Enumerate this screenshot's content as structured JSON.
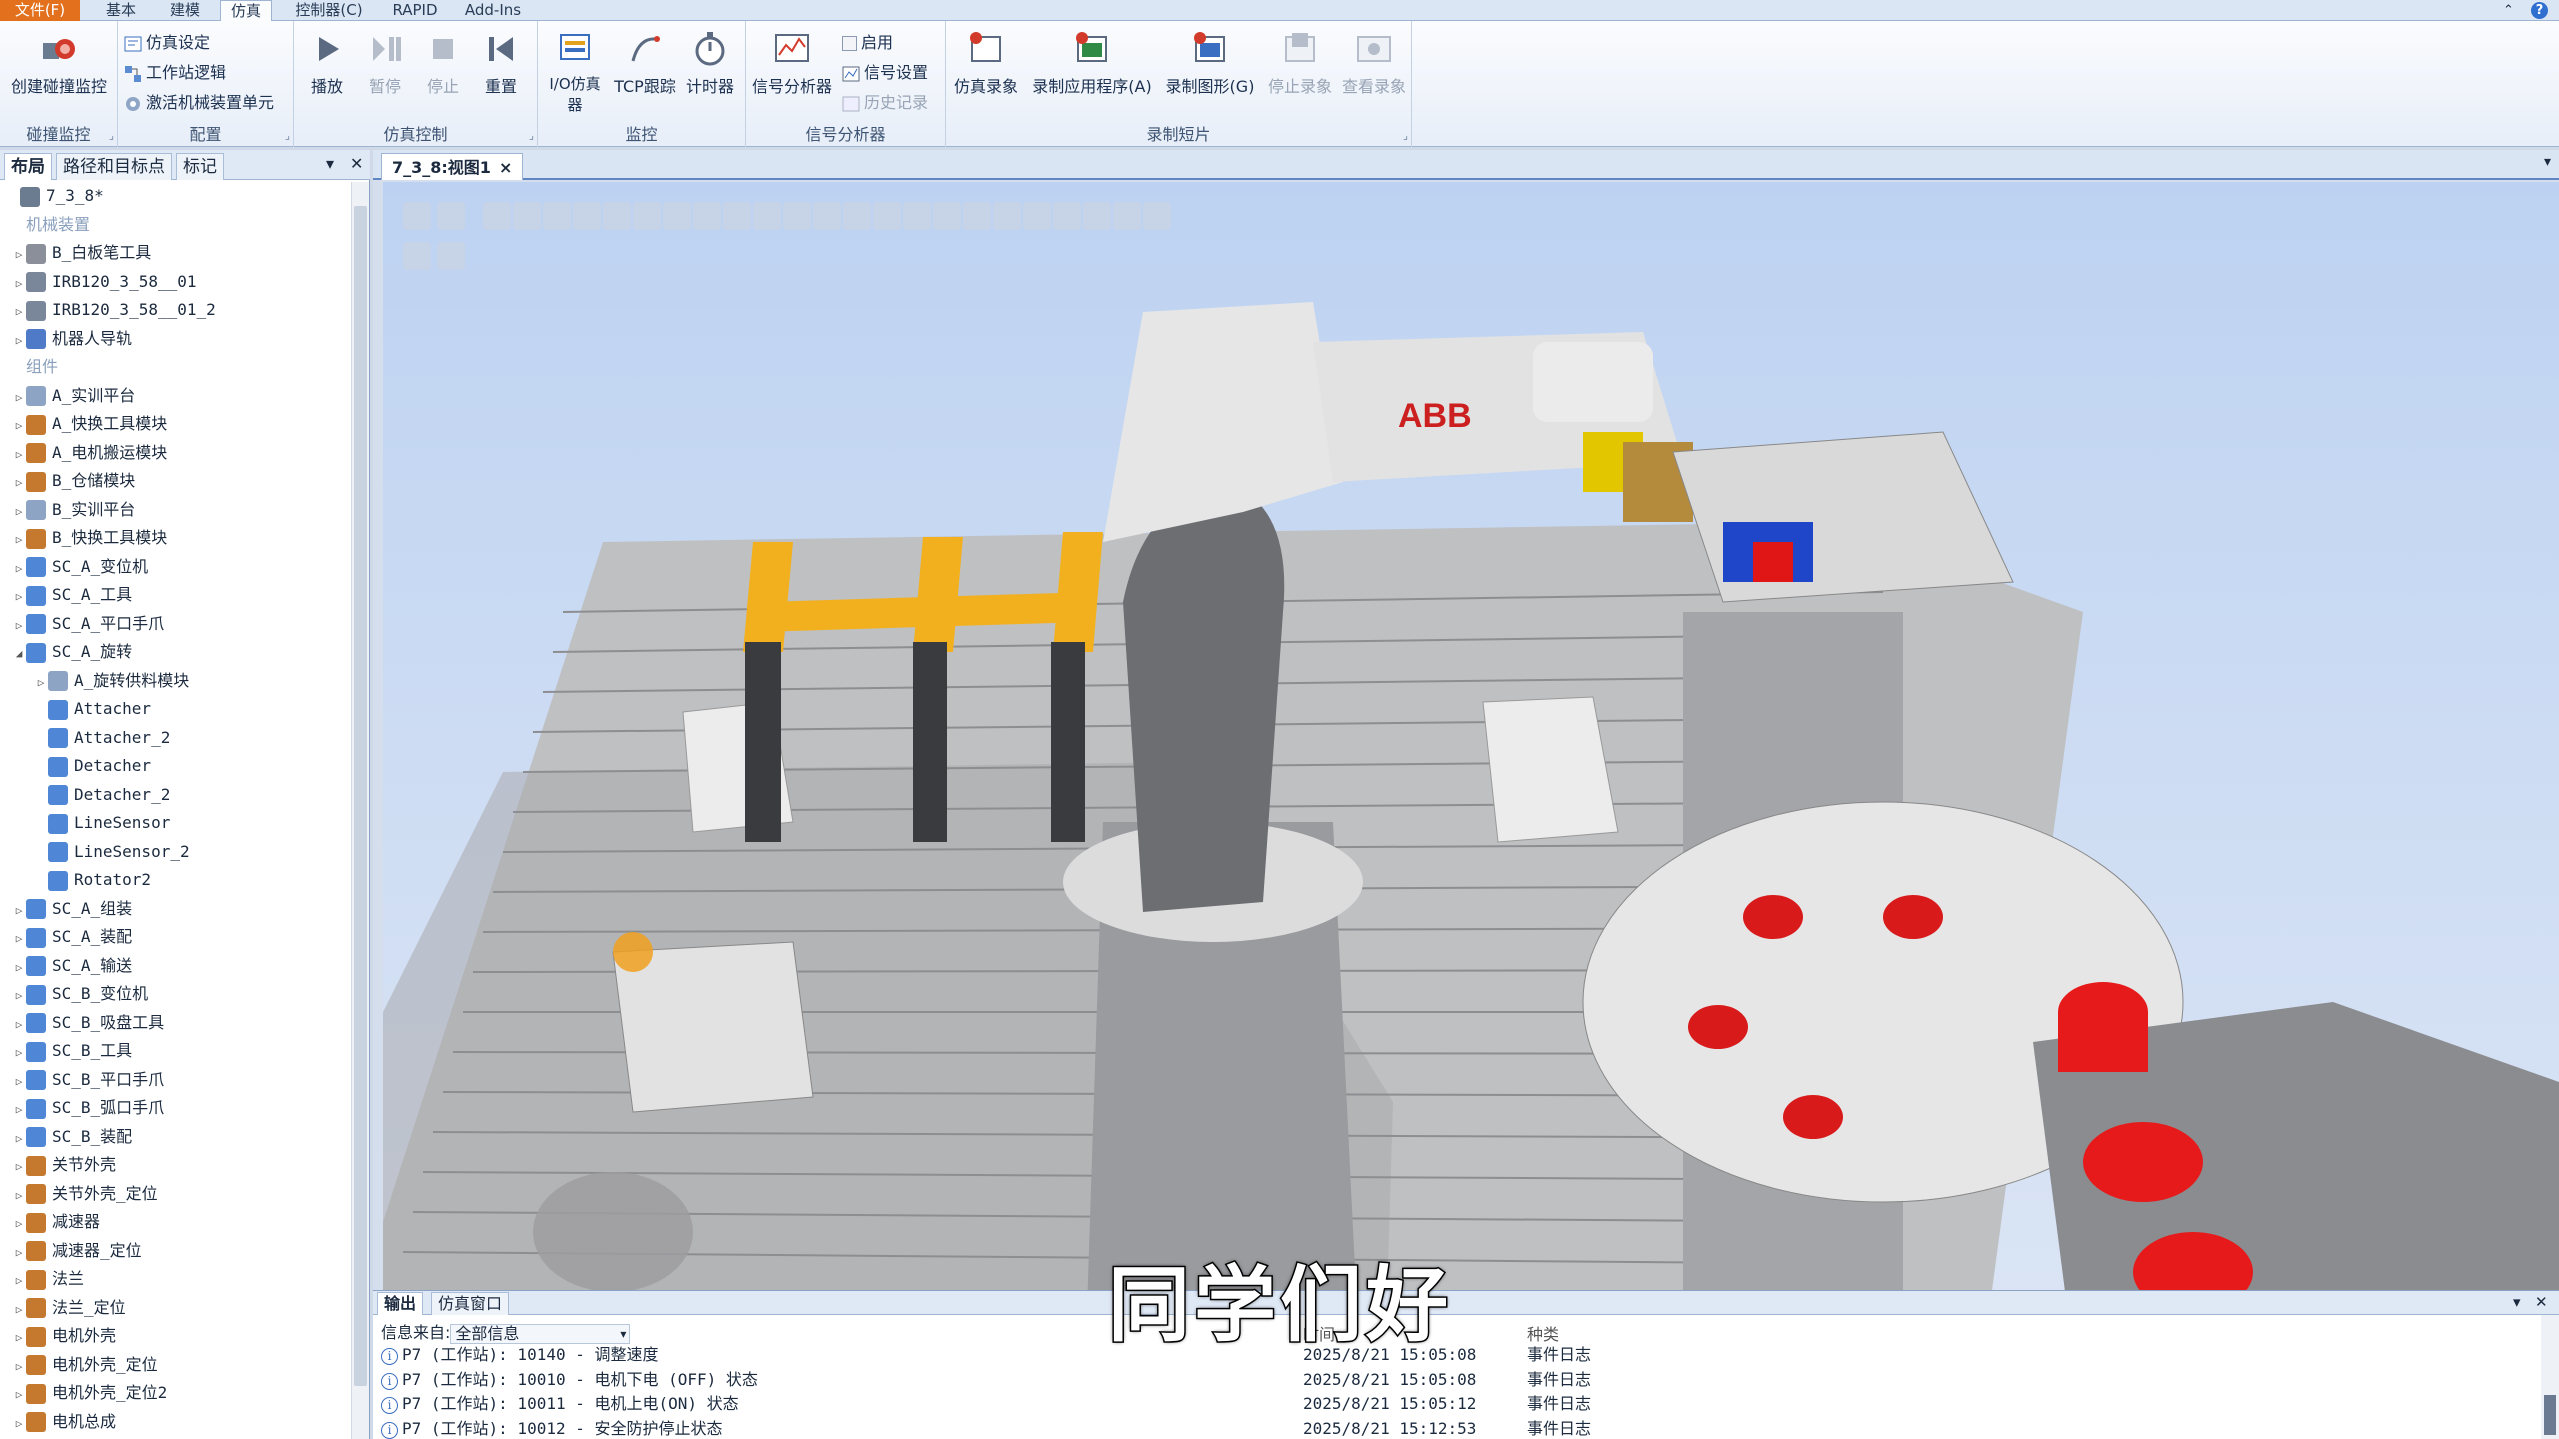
{
  "ribbon_tabs": {
    "file": "文件(F)",
    "home": "基本",
    "modeling": "建模",
    "simulation": "仿真",
    "controller": "控制器(C)",
    "rapid": "RAPID",
    "addins": "Add-Ins"
  },
  "ribbon": {
    "collision": {
      "create_label": "创建碰撞监控",
      "group_label": "碰撞监控"
    },
    "config": {
      "sim_setup": "仿真设定",
      "station_logic": "工作站逻辑",
      "activate_mech": "激活机械装置单元",
      "group_label": "配置"
    },
    "sim_control": {
      "play": "播放",
      "pause": "暂停",
      "stop": "停止",
      "reset": "重置",
      "group_label": "仿真控制"
    },
    "monitor": {
      "io_sim": "I/O仿真器",
      "tcp_trace": "TCP跟踪",
      "timer": "计时器",
      "group_label": "监控"
    },
    "signal_analyzer": {
      "analyzer": "信号分析器",
      "enable": "启用",
      "signal_settings": "信号设置",
      "history": "历史记录",
      "group_label": "信号分析器"
    },
    "recording": {
      "sim_record": "仿真录象",
      "record_app": "录制应用程序(A)",
      "record_graphics": "录制图形(G)",
      "stop_record": "停止录象",
      "view_record": "查看录象",
      "group_label": "录制短片"
    }
  },
  "left_panel": {
    "tabs": [
      "布局",
      "路径和目标点",
      "标记"
    ],
    "tree": [
      {
        "label": "7_3_8*",
        "level": 0,
        "icon": "station-icon",
        "twisty": "",
        "category": false
      },
      {
        "label": "机械装置",
        "level": 1,
        "icon": "",
        "twisty": "",
        "category": true
      },
      {
        "label": "B_白板笔工具",
        "level": 1,
        "icon": "tool-icon",
        "twisty": "▷",
        "category": false
      },
      {
        "label": "IRB120_3_58__01",
        "level": 1,
        "icon": "robot-icon",
        "twisty": "▷",
        "category": false
      },
      {
        "label": "IRB120_3_58__01_2",
        "level": 1,
        "icon": "robot-icon",
        "twisty": "▷",
        "category": false
      },
      {
        "label": "机器人导轨",
        "level": 1,
        "icon": "track-icon",
        "twisty": "▷",
        "category": false
      },
      {
        "label": "组件",
        "level": 1,
        "icon": "",
        "twisty": "",
        "category": true
      },
      {
        "label": "A_实训平台",
        "level": 1,
        "icon": "component-icon",
        "twisty": "▷",
        "category": false
      },
      {
        "label": "A_快换工具模块",
        "level": 1,
        "icon": "component-group-icon",
        "twisty": "▷",
        "category": false
      },
      {
        "label": "A_电机搬运模块",
        "level": 1,
        "icon": "component-group-icon",
        "twisty": "▷",
        "category": false
      },
      {
        "label": "B_仓储模块",
        "level": 1,
        "icon": "component-group-icon",
        "twisty": "▷",
        "category": false
      },
      {
        "label": "B_实训平台",
        "level": 1,
        "icon": "component-icon",
        "twisty": "▷",
        "category": false
      },
      {
        "label": "B_快换工具模块",
        "level": 1,
        "icon": "component-group-icon",
        "twisty": "▷",
        "category": false
      },
      {
        "label": "SC_A_变位机",
        "level": 1,
        "icon": "smart-component-icon",
        "twisty": "▷",
        "category": false
      },
      {
        "label": "SC_A_工具",
        "level": 1,
        "icon": "smart-component-icon",
        "twisty": "▷",
        "category": false
      },
      {
        "label": "SC_A_平口手爪",
        "level": 1,
        "icon": "smart-component-icon",
        "twisty": "▷",
        "category": false
      },
      {
        "label": "SC_A_旋转",
        "level": 1,
        "icon": "smart-component-icon",
        "twisty": "◢",
        "category": false
      },
      {
        "label": "A_旋转供料模块",
        "level": 2,
        "icon": "component-icon",
        "twisty": "▷",
        "category": false
      },
      {
        "label": "Attacher",
        "level": 2,
        "icon": "smart-component-icon",
        "twisty": "",
        "category": false
      },
      {
        "label": "Attacher_2",
        "level": 2,
        "icon": "smart-component-icon",
        "twisty": "",
        "category": false
      },
      {
        "label": "Detacher",
        "level": 2,
        "icon": "smart-component-icon",
        "twisty": "",
        "category": false
      },
      {
        "label": "Detacher_2",
        "level": 2,
        "icon": "smart-component-icon",
        "twisty": "",
        "category": false
      },
      {
        "label": "LineSensor",
        "level": 2,
        "icon": "smart-component-icon",
        "twisty": "",
        "category": false
      },
      {
        "label": "LineSensor_2",
        "level": 2,
        "icon": "smart-component-icon",
        "twisty": "",
        "category": false
      },
      {
        "label": "Rotator2",
        "level": 2,
        "icon": "smart-component-icon",
        "twisty": "",
        "category": false
      },
      {
        "label": "SC_A_组装",
        "level": 1,
        "icon": "smart-component-icon",
        "twisty": "▷",
        "category": false
      },
      {
        "label": "SC_A_装配",
        "level": 1,
        "icon": "smart-component-icon",
        "twisty": "▷",
        "category": false
      },
      {
        "label": "SC_A_输送",
        "level": 1,
        "icon": "smart-component-icon",
        "twisty": "▷",
        "category": false
      },
      {
        "label": "SC_B_变位机",
        "level": 1,
        "icon": "smart-component-icon",
        "twisty": "▷",
        "category": false
      },
      {
        "label": "SC_B_吸盘工具",
        "level": 1,
        "icon": "smart-component-icon",
        "twisty": "▷",
        "category": false
      },
      {
        "label": "SC_B_工具",
        "level": 1,
        "icon": "smart-component-icon",
        "twisty": "▷",
        "category": false
      },
      {
        "label": "SC_B_平口手爪",
        "level": 1,
        "icon": "smart-component-icon",
        "twisty": "▷",
        "category": false
      },
      {
        "label": "SC_B_弧口手爪",
        "level": 1,
        "icon": "smart-component-icon",
        "twisty": "▷",
        "category": false
      },
      {
        "label": "SC_B_装配",
        "level": 1,
        "icon": "smart-component-icon",
        "twisty": "▷",
        "category": false
      },
      {
        "label": "关节外壳",
        "level": 1,
        "icon": "component-group-icon",
        "twisty": "▷",
        "category": false
      },
      {
        "label": "关节外壳_定位",
        "level": 1,
        "icon": "component-group-icon",
        "twisty": "▷",
        "category": false
      },
      {
        "label": "减速器",
        "level": 1,
        "icon": "component-group-icon",
        "twisty": "▷",
        "category": false
      },
      {
        "label": "减速器_定位",
        "level": 1,
        "icon": "component-group-icon",
        "twisty": "▷",
        "category": false
      },
      {
        "label": "法兰",
        "level": 1,
        "icon": "component-group-icon",
        "twisty": "▷",
        "category": false
      },
      {
        "label": "法兰_定位",
        "level": 1,
        "icon": "component-group-icon",
        "twisty": "▷",
        "category": false
      },
      {
        "label": "电机外壳",
        "level": 1,
        "icon": "component-group-icon",
        "twisty": "▷",
        "category": false
      },
      {
        "label": "电机外壳_定位",
        "level": 1,
        "icon": "component-group-icon",
        "twisty": "▷",
        "category": false
      },
      {
        "label": "电机外壳_定位2",
        "level": 1,
        "icon": "component-group-icon",
        "twisty": "▷",
        "category": false
      },
      {
        "label": "电机总成",
        "level": 1,
        "icon": "component-group-icon",
        "twisty": "▷",
        "category": false
      }
    ]
  },
  "document": {
    "tab_label": "7_3_8:视图1",
    "close": "×"
  },
  "viewport": {
    "robot_brand": "ABB",
    "axis_y_label": "Y"
  },
  "output": {
    "tabs": [
      "输出",
      "仿真窗口"
    ],
    "filter_label": "信息来自:",
    "filter_value": "全部信息",
    "col_time": "时间",
    "col_category": "种类",
    "rows": [
      {
        "message": "P7 (工作站): 10140 - 调整速度",
        "time": "2025/8/21 15:05:08",
        "category": "事件日志"
      },
      {
        "message": "P7 (工作站): 10010 - 电机下电 (OFF) 状态",
        "time": "2025/8/21 15:05:08",
        "category": "事件日志"
      },
      {
        "message": "P7 (工作站): 10011 - 电机上电(ON) 状态",
        "time": "2025/8/21 15:05:12",
        "category": "事件日志"
      },
      {
        "message": "P7 (工作站): 10012 - 安全防护停止状态",
        "time": "2025/8/21 15:12:53",
        "category": "事件日志"
      }
    ]
  },
  "subtitle": "同学们好",
  "colors": {
    "file_tab": "#e2701c",
    "accent_blue": "#5f86c2",
    "robot_body": "#e2e2e2",
    "fixture_yellow": "#f2b01e",
    "part_red": "#e01515"
  }
}
